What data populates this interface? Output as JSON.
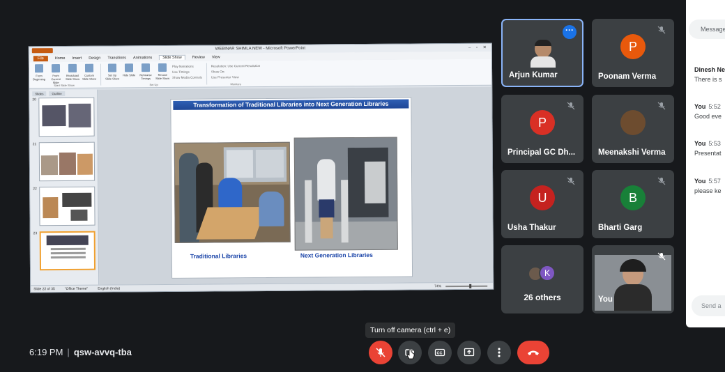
{
  "presentation": {
    "window_title": "WEBINAR SHIMLA NEW - Microsoft PowerPoint",
    "tabs": [
      "File",
      "Home",
      "Insert",
      "Design",
      "Transitions",
      "Animations",
      "Slide Show",
      "Review",
      "View"
    ],
    "active_tab": "Slide Show",
    "ribbon_buttons": [
      "From Beginning",
      "From Current Slide",
      "Broadcast Slide Show",
      "Custom Slide Show",
      "Set Up Slide Show",
      "Hide Slide",
      "Rehearse Timings",
      "Record Slide Show"
    ],
    "ribbon_checks": [
      "Play Narrations",
      "Use Timings",
      "Show Media Controls"
    ],
    "ribbon_monitor": [
      "Resolution: Use Current Resolution",
      "Show On:",
      "Use Presenter View"
    ],
    "ribbon_groups": [
      "Start Slide Show",
      "Set Up",
      "Monitors"
    ],
    "pane_tabs": [
      "Slides",
      "Outline"
    ],
    "thumb_numbers": [
      "20",
      "21",
      "22",
      "23"
    ],
    "slide": {
      "title": "Transformation of Traditional Libraries into Next Generation Libraries",
      "caption_left": "Traditional Libraries",
      "caption_right": "Next Generation Libraries"
    },
    "status": {
      "slide_info": "Slide 22 of 35",
      "theme": "\"Office Theme\"",
      "language": "English (India)",
      "zoom": "74%"
    }
  },
  "participants": [
    {
      "name": "Arjun Kumar",
      "type": "video",
      "active": true
    },
    {
      "name": "Poonam Verma",
      "initial": "P",
      "color": "#e8590c",
      "muted": true
    },
    {
      "name": "Principal GC Dh...",
      "initial": "P",
      "color": "#d93025",
      "muted": true
    },
    {
      "name": "Meenakshi Verma",
      "type": "photo",
      "muted": true
    },
    {
      "name": "Usha Thakur",
      "initial": "U",
      "color": "#c5221f",
      "muted": true
    },
    {
      "name": "Bharti Garg",
      "initial": "B",
      "color": "#188038",
      "muted": true
    },
    {
      "name": "26 others",
      "initial": "K"
    },
    {
      "name": "You",
      "type": "video",
      "muted": true
    }
  ],
  "chat": {
    "search_placeholder": "Message",
    "messages": [
      {
        "sender": "Dinesh Ne",
        "time": "",
        "text": "There is s"
      },
      {
        "sender": "You",
        "time": "5:52",
        "text": "Good eve"
      },
      {
        "sender": "You",
        "time": "5:53",
        "text": "Presentat"
      },
      {
        "sender": "You",
        "time": "5:57",
        "text": "please ke"
      }
    ],
    "input_placeholder": "Send a"
  },
  "meeting": {
    "time": "6:19 PM",
    "separator": "|",
    "code": "qsw-avvq-tba"
  },
  "controls": {
    "tooltip": "Turn off camera (ctrl + e)",
    "mic_state": "off",
    "colors": {
      "danger": "#ea4335",
      "button": "#3c4043",
      "accent": "#1a73e8"
    }
  }
}
